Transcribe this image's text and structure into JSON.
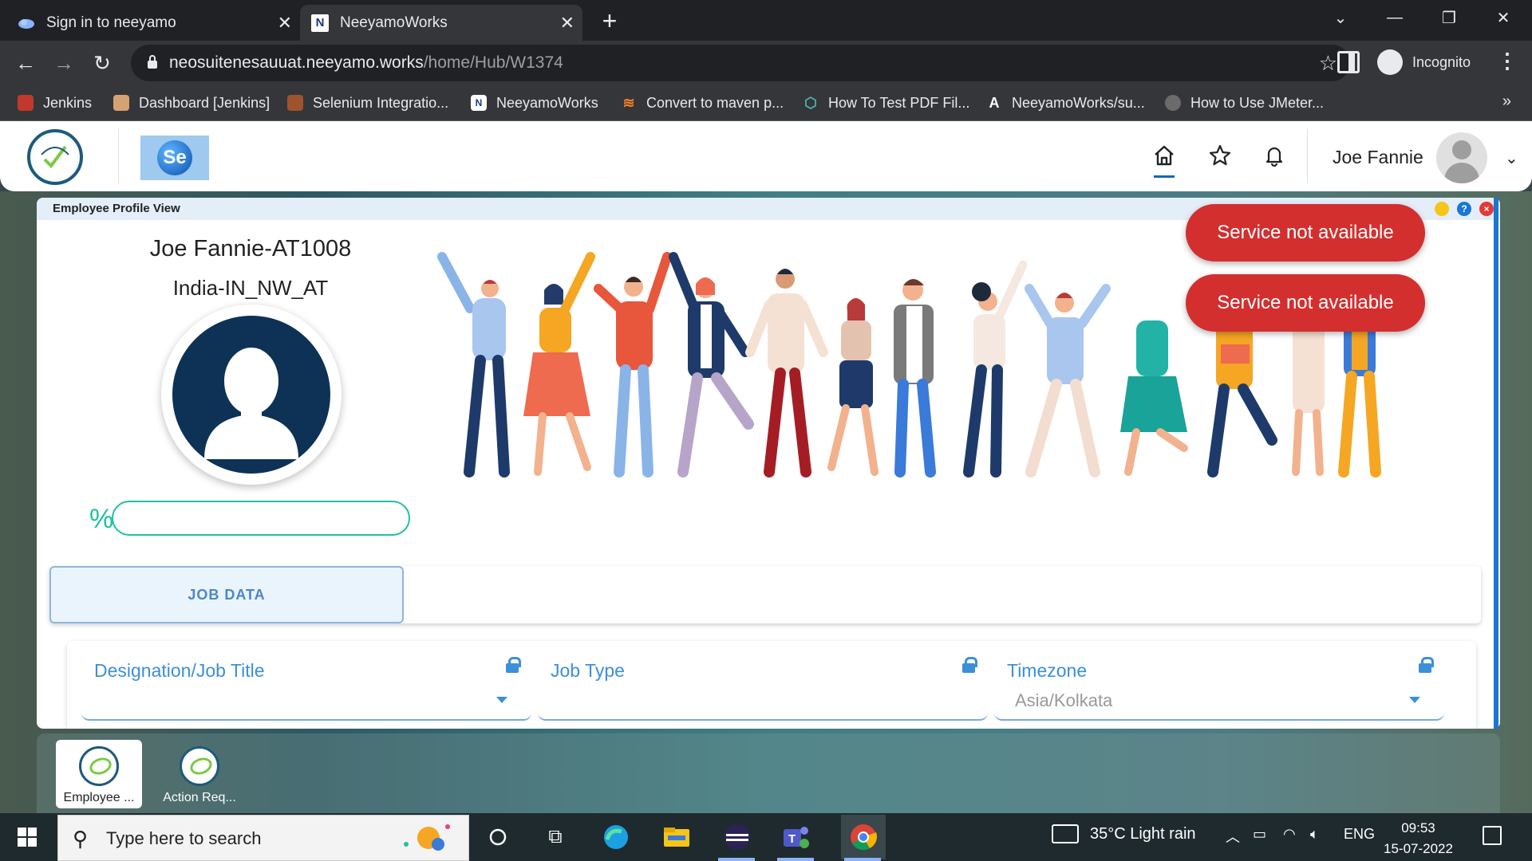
{
  "browser": {
    "tabs": [
      {
        "title": "Sign in to neeyamo",
        "active": false
      },
      {
        "title": "NeeyamoWorks",
        "active": true,
        "favicon_letter": "N"
      }
    ],
    "url_host": "neosuitenesauuat.neeyamo.works",
    "url_path": "/home/Hub/W1374",
    "profile_label": "Incognito",
    "bookmarks": [
      {
        "label": "Jenkins",
        "icon": "jenkins-icon"
      },
      {
        "label": "Dashboard [Jenkins]",
        "icon": "jenkins-icon"
      },
      {
        "label": "Selenium Integratio...",
        "icon": "selenium-icon"
      },
      {
        "label": "NeeyamoWorks",
        "icon": "neeyamo-icon"
      },
      {
        "label": "Convert to maven p...",
        "icon": "stackoverflow-icon"
      },
      {
        "label": "How To Test PDF Fil...",
        "icon": "guide-icon"
      },
      {
        "label": "NeeyamoWorks/su...",
        "icon": "a-icon"
      },
      {
        "label": "How to Use JMeter...",
        "icon": "globe-icon"
      }
    ]
  },
  "app_header": {
    "logo2_text": "Se",
    "user_name": "Joe Fannie",
    "icons": [
      "home-icon",
      "star-icon",
      "bell-icon"
    ]
  },
  "profile_window": {
    "title": "Employee Profile View",
    "employee_name": "Joe Fannie-AT1008",
    "location": "India-IN_NW_AT",
    "percent_symbol": "%",
    "completion_fraction": 0,
    "tabs": [
      {
        "label": "JOB DATA",
        "active": true
      }
    ],
    "fields": [
      {
        "label": "Designation/Job Title",
        "value": "",
        "locked": true,
        "dropdown": true
      },
      {
        "label": "Job Type",
        "value": "",
        "locked": true,
        "dropdown": false
      },
      {
        "label": "Timezone",
        "value": "Asia/Kolkata",
        "locked": true,
        "dropdown": true
      }
    ]
  },
  "toasts": [
    "Service not available",
    "Service not available"
  ],
  "dock": [
    {
      "label": "Employee ...",
      "active": true
    },
    {
      "label": "Action Req...",
      "active": false
    }
  ],
  "taskbar": {
    "search_placeholder": "Type here to search",
    "weather": "35°C  Light rain",
    "language": "ENG",
    "time": "09:53",
    "date": "15-07-2022"
  },
  "colors": {
    "accent_blue": "#3c8fd9",
    "toast_red": "#d32f2f",
    "progress_green": "#22c0a0",
    "avatar_navy": "#0d3255"
  }
}
